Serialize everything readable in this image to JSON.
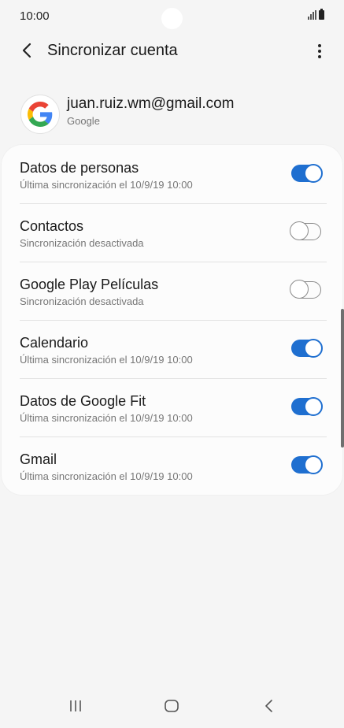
{
  "status_bar": {
    "time": "10:00"
  },
  "app_bar": {
    "title": "Sincronizar cuenta"
  },
  "account": {
    "email": "juan.ruiz.wm@gmail.com",
    "provider": "Google"
  },
  "sync_items": [
    {
      "title": "Datos de personas",
      "subtitle": "Última sincronización el 10/9/19  10:00",
      "enabled": true
    },
    {
      "title": "Contactos",
      "subtitle": "Sincronización desactivada",
      "enabled": false
    },
    {
      "title": "Google Play Películas",
      "subtitle": "Sincronización desactivada",
      "enabled": false
    },
    {
      "title": "Calendario",
      "subtitle": "Última sincronización el 10/9/19  10:00",
      "enabled": true
    },
    {
      "title": "Datos de Google Fit",
      "subtitle": "Última sincronización el 10/9/19  10:00",
      "enabled": true
    },
    {
      "title": "Gmail",
      "subtitle": "Última sincronización el 10/9/19  10:00",
      "enabled": true
    }
  ],
  "icons": {
    "back": "chevron-left-icon",
    "more": "more-vertical-icon",
    "account": "google-logo-icon",
    "nav_recent": "recent-apps-icon",
    "nav_home": "home-icon",
    "nav_back": "back-icon"
  },
  "colors": {
    "accent": "#1f6fd0",
    "background": "#f5f5f5",
    "card": "#fcfcfc"
  }
}
